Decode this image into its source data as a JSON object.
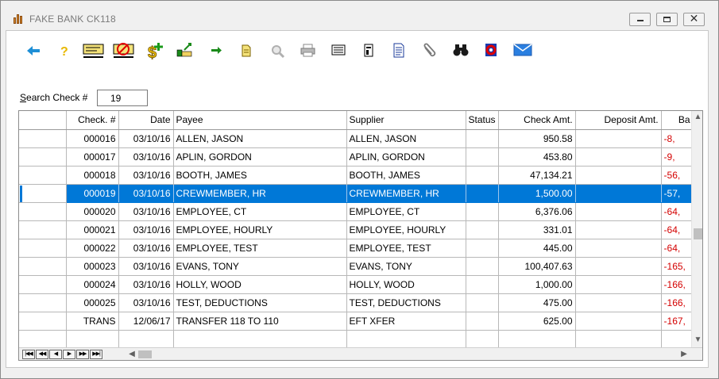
{
  "window": {
    "title": "FAKE BANK  CK118",
    "close_glyph": "✕"
  },
  "toolbar": {
    "icons": [
      "back-arrow-icon",
      "help-icon",
      "check-icon",
      "void-check-icon",
      "add-money-icon",
      "deposit-icon",
      "forward-arrow-icon",
      "document-icon",
      "search-magnifier-icon",
      "print-icon",
      "list-icon",
      "form-icon",
      "report-icon",
      "paperclip-icon",
      "binoculars-icon",
      "refresh-icon",
      "email-icon"
    ]
  },
  "search": {
    "label_prefix": "S",
    "label_rest": "earch Check #",
    "value": "19"
  },
  "grid": {
    "columns": [
      "Check. #",
      "Date",
      "Payee",
      "Supplier",
      "Status",
      "Check Amt.",
      "Deposit Amt.",
      "Ba"
    ],
    "rows": [
      {
        "check": "000016",
        "date": "03/10/16",
        "payee": "ALLEN, JASON",
        "supplier": "ALLEN, JASON",
        "status": "",
        "check_amt": "950.58",
        "deposit_amt": "",
        "balance": "-8,"
      },
      {
        "check": "000017",
        "date": "03/10/16",
        "payee": "APLIN, GORDON",
        "supplier": "APLIN, GORDON",
        "status": "",
        "check_amt": "453.80",
        "deposit_amt": "",
        "balance": "-9,"
      },
      {
        "check": "000018",
        "date": "03/10/16",
        "payee": "BOOTH, JAMES",
        "supplier": "BOOTH, JAMES",
        "status": "",
        "check_amt": "47,134.21",
        "deposit_amt": "",
        "balance": "-56,"
      },
      {
        "check": "000019",
        "date": "03/10/16",
        "payee": "CREWMEMBER, HR",
        "supplier": "CREWMEMBER, HR",
        "status": "",
        "check_amt": "1,500.00",
        "deposit_amt": "",
        "balance": "-57,",
        "selected": true
      },
      {
        "check": "000020",
        "date": "03/10/16",
        "payee": "EMPLOYEE, CT",
        "supplier": "EMPLOYEE, CT",
        "status": "",
        "check_amt": "6,376.06",
        "deposit_amt": "",
        "balance": "-64,"
      },
      {
        "check": "000021",
        "date": "03/10/16",
        "payee": "EMPLOYEE, HOURLY",
        "supplier": "EMPLOYEE, HOURLY",
        "status": "",
        "check_amt": "331.01",
        "deposit_amt": "",
        "balance": "-64,"
      },
      {
        "check": "000022",
        "date": "03/10/16",
        "payee": "EMPLOYEE, TEST",
        "supplier": "EMPLOYEE, TEST",
        "status": "",
        "check_amt": "445.00",
        "deposit_amt": "",
        "balance": "-64,"
      },
      {
        "check": "000023",
        "date": "03/10/16",
        "payee": "EVANS, TONY",
        "supplier": "EVANS, TONY",
        "status": "",
        "check_amt": "100,407.63",
        "deposit_amt": "",
        "balance": "-165,"
      },
      {
        "check": "000024",
        "date": "03/10/16",
        "payee": "HOLLY, WOOD",
        "supplier": "HOLLY, WOOD",
        "status": "",
        "check_amt": "1,000.00",
        "deposit_amt": "",
        "balance": "-166,"
      },
      {
        "check": "000025",
        "date": "03/10/16",
        "payee": "TEST, DEDUCTIONS",
        "supplier": "TEST, DEDUCTIONS",
        "status": "",
        "check_amt": "475.00",
        "deposit_amt": "",
        "balance": "-166,"
      },
      {
        "check": "TRANS",
        "date": "12/06/17",
        "payee": "TRANSFER 118 TO 110",
        "supplier": "EFT XFER",
        "status": "",
        "check_amt": "625.00",
        "deposit_amt": "",
        "balance": "-167,"
      },
      {
        "check": "",
        "date": "",
        "payee": "",
        "supplier": "",
        "status": "",
        "check_amt": "",
        "deposit_amt": "",
        "balance": ""
      }
    ]
  },
  "navigator": {
    "first": "|◀◀",
    "prev_page": "◀◀",
    "prev": "◀",
    "next": "▶",
    "next_page": "▶▶",
    "last": "▶▶|"
  },
  "scroll": {
    "up": "▲",
    "down": "▼",
    "left": "◀",
    "right": "▶"
  },
  "colors": {
    "selection": "#0078d7",
    "negative": "#d40000"
  }
}
